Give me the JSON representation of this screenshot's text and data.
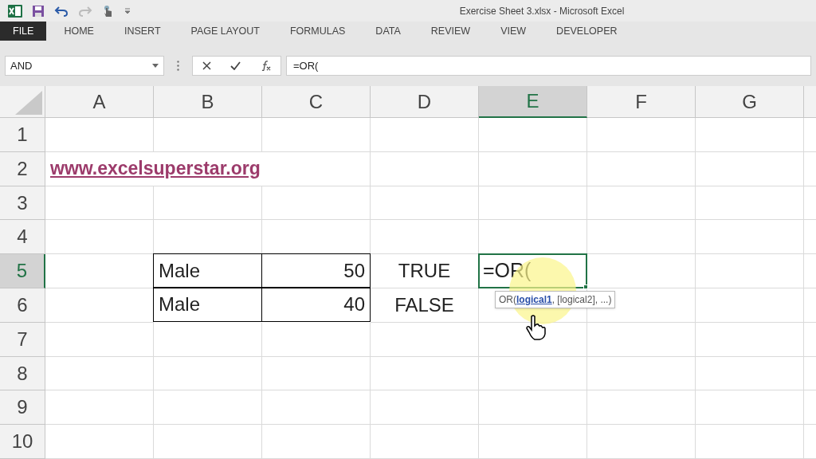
{
  "window": {
    "title": "Exercise Sheet 3.xlsx - Microsoft Excel"
  },
  "ribbon_tabs": [
    {
      "label": "FILE",
      "kind": "file",
      "selected": false
    },
    {
      "label": "HOME",
      "kind": "tab",
      "selected": false
    },
    {
      "label": "INSERT",
      "kind": "tab",
      "selected": false
    },
    {
      "label": "PAGE LAYOUT",
      "kind": "tab",
      "selected": false
    },
    {
      "label": "FORMULAS",
      "kind": "tab",
      "selected": false
    },
    {
      "label": "DATA",
      "kind": "tab",
      "selected": false
    },
    {
      "label": "REVIEW",
      "kind": "tab",
      "selected": false
    },
    {
      "label": "VIEW",
      "kind": "tab",
      "selected": false
    },
    {
      "label": "DEVELOPER",
      "kind": "tab",
      "selected": false
    }
  ],
  "name_box": {
    "value": "AND"
  },
  "formula_bar": {
    "value": "=OR("
  },
  "columns": [
    {
      "label": "A",
      "selected": false
    },
    {
      "label": "B",
      "selected": false
    },
    {
      "label": "C",
      "selected": false
    },
    {
      "label": "D",
      "selected": false
    },
    {
      "label": "E",
      "selected": true
    },
    {
      "label": "F",
      "selected": false
    },
    {
      "label": "G",
      "selected": false
    }
  ],
  "rows": [
    {
      "label": "1",
      "selected": false,
      "cells": [
        {
          "kind": "empty"
        },
        {
          "kind": "empty"
        },
        {
          "kind": "empty"
        },
        {
          "kind": "empty"
        },
        {
          "kind": "empty"
        },
        {
          "kind": "empty"
        },
        {
          "kind": "empty"
        }
      ]
    },
    {
      "label": "2",
      "selected": false,
      "cells": [
        {
          "text": "www.excelsuperstar.org",
          "kind": "link"
        },
        {
          "kind": "empty"
        },
        {
          "kind": "empty"
        },
        {
          "kind": "empty"
        },
        {
          "kind": "empty"
        },
        {
          "kind": "empty"
        },
        {
          "kind": "empty"
        }
      ]
    },
    {
      "label": "3",
      "selected": false,
      "cells": [
        {
          "kind": "empty"
        },
        {
          "kind": "empty"
        },
        {
          "kind": "empty"
        },
        {
          "kind": "empty"
        },
        {
          "kind": "empty"
        },
        {
          "kind": "empty"
        },
        {
          "kind": "empty"
        }
      ]
    },
    {
      "label": "4",
      "selected": false,
      "cells": [
        {
          "kind": "empty"
        },
        {
          "kind": "empty"
        },
        {
          "kind": "empty"
        },
        {
          "kind": "empty"
        },
        {
          "kind": "empty"
        },
        {
          "kind": "empty"
        },
        {
          "kind": "empty"
        }
      ]
    },
    {
      "label": "5",
      "selected": true,
      "cells": [
        {
          "kind": "empty"
        },
        {
          "text": "Male",
          "kind": "text",
          "bordered": true
        },
        {
          "text": "50",
          "kind": "number",
          "bordered": true
        },
        {
          "text": "TRUE",
          "kind": "boolean",
          "bordered": false
        },
        {
          "text": "=OR(",
          "kind": "editing",
          "tooltip": "OR(**logical1**, [logical2], ...)"
        },
        {
          "kind": "empty"
        },
        {
          "kind": "empty"
        }
      ]
    },
    {
      "label": "6",
      "selected": false,
      "cells": [
        {
          "kind": "empty"
        },
        {
          "text": "Male",
          "kind": "text",
          "bordered": true
        },
        {
          "text": "40",
          "kind": "number",
          "bordered": true
        },
        {
          "text": "FALSE",
          "kind": "boolean",
          "bordered": false
        },
        {
          "kind": "empty"
        },
        {
          "kind": "empty"
        },
        {
          "kind": "empty"
        }
      ]
    },
    {
      "label": "7",
      "selected": false,
      "cells": [
        {
          "kind": "empty"
        },
        {
          "kind": "empty"
        },
        {
          "kind": "empty"
        },
        {
          "kind": "empty"
        },
        {
          "kind": "empty"
        },
        {
          "kind": "empty"
        },
        {
          "kind": "empty"
        }
      ]
    },
    {
      "label": "8",
      "selected": false,
      "cells": [
        {
          "kind": "empty"
        },
        {
          "kind": "empty"
        },
        {
          "kind": "empty"
        },
        {
          "kind": "empty"
        },
        {
          "kind": "empty"
        },
        {
          "kind": "empty"
        },
        {
          "kind": "empty"
        }
      ]
    },
    {
      "label": "9",
      "selected": false,
      "cells": [
        {
          "kind": "empty"
        },
        {
          "kind": "empty"
        },
        {
          "kind": "empty"
        },
        {
          "kind": "empty"
        },
        {
          "kind": "empty"
        },
        {
          "kind": "empty"
        },
        {
          "kind": "empty"
        }
      ]
    },
    {
      "label": "10",
      "selected": false,
      "cells": [
        {
          "kind": "empty"
        },
        {
          "kind": "empty"
        },
        {
          "kind": "empty"
        },
        {
          "kind": "empty"
        },
        {
          "kind": "empty"
        },
        {
          "kind": "empty"
        },
        {
          "kind": "empty"
        }
      ]
    }
  ]
}
